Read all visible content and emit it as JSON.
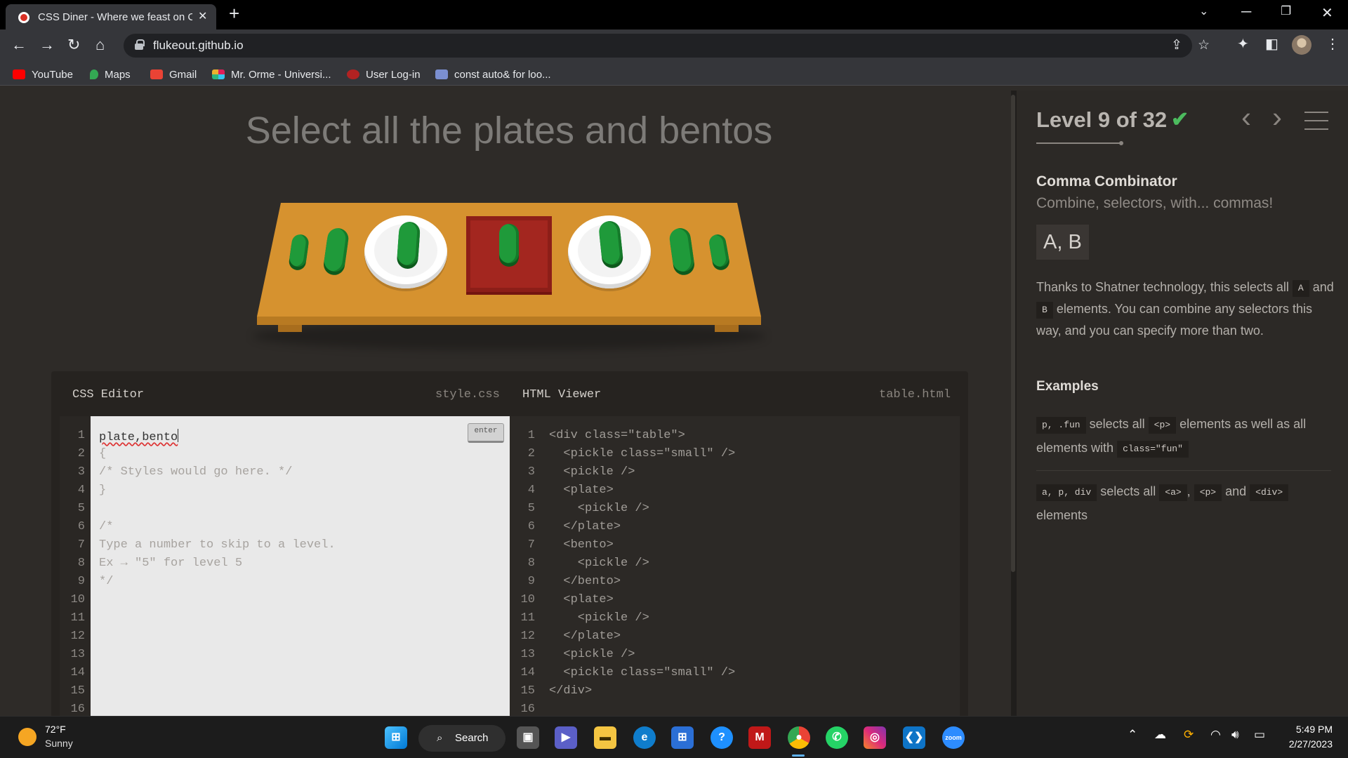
{
  "browser": {
    "tab_title": "CSS Diner - Where we feast on C",
    "close_glyph": "✕",
    "newtab_glyph": "+",
    "url": "flukeout.github.io",
    "bookmarks": [
      {
        "label": "YouTube",
        "color": "#ff0000"
      },
      {
        "label": "Maps",
        "color": "#34a853"
      },
      {
        "label": "Gmail",
        "color": "#ea4335"
      },
      {
        "label": "Mr. Orme - Universi...",
        "color": "#4a154b"
      },
      {
        "label": "User Log-in",
        "color": "#b22222"
      },
      {
        "label": "const auto& for loo...",
        "color": "#7b8fd1"
      }
    ]
  },
  "game": {
    "instruction": "Select all the plates and bentos"
  },
  "css_editor": {
    "title": "CSS Editor",
    "filename": "style.css",
    "enter_label": "enter",
    "input_value": "plate,bento",
    "line_numbers": [
      "1",
      "2",
      "3",
      "4",
      "5",
      "6",
      "7",
      "8",
      "9",
      "10",
      "11",
      "12",
      "13",
      "14",
      "15",
      "16"
    ],
    "lines": [
      "{",
      "/* Styles would go here. */",
      "}",
      "",
      "/*",
      "Type a number to skip to a level.",
      "Ex → \"5\" for level 5",
      "*/"
    ]
  },
  "html_viewer": {
    "title": "HTML Viewer",
    "filename": "table.html",
    "line_numbers": [
      "1",
      "2",
      "3",
      "4",
      "5",
      "6",
      "7",
      "8",
      "9",
      "10",
      "11",
      "12",
      "13",
      "14",
      "15",
      "16"
    ],
    "lines": [
      "<div class=\"table\">",
      "  <pickle class=\"small\" />",
      "  <pickle />",
      "  <plate>",
      "    <pickle />",
      "  </plate>",
      "  <bento>",
      "    <pickle />",
      "  </bento>",
      "  <plate>",
      "    <pickle />",
      "  </plate>",
      "  <pickle />",
      "  <pickle class=\"small\" />",
      "</div>"
    ]
  },
  "sidebar": {
    "level_label": "Level 9 of 32",
    "check": "✔",
    "prev_glyph": "‹",
    "next_glyph": "›",
    "title": "Comma Combinator",
    "subtitle": "Combine, selectors, with... commas!",
    "syntax": "A, B",
    "desc": {
      "p1": "Thanks to Shatner technology, this selects all ",
      "tag_a": "A",
      "p2": " and ",
      "tag_b": "B",
      "p3": " elements. You can combine any selectors this way, and you can specify more than two."
    },
    "examples_heading": "Examples",
    "example1": {
      "code": "p, .fun",
      "t1": " selects all ",
      "tag1": "<p>",
      "t2": " elements as well as all elements with ",
      "tag2": "class=\"fun\""
    },
    "example2": {
      "code": "a, p, div",
      "t1": " selects all ",
      "tag1": "<a>",
      "t2": ", ",
      "tag2": "<p>",
      "t3": " and ",
      "tag3": "<div>",
      "t4": " elements"
    }
  },
  "taskbar": {
    "temperature": "72°F",
    "condition": "Sunny",
    "search_label": "Search",
    "time": "5:49 PM",
    "date": "2/27/2023"
  }
}
